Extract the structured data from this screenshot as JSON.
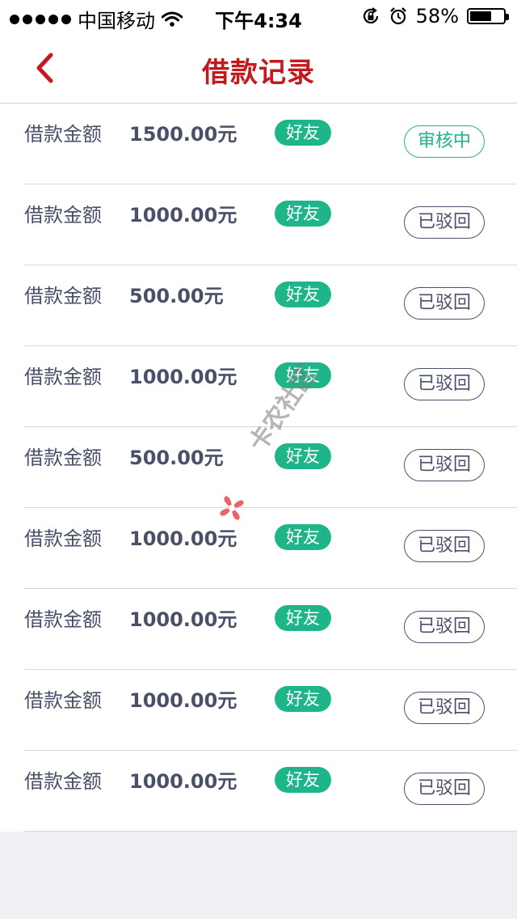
{
  "status_bar": {
    "carrier": "中国移动",
    "time": "下午4:34",
    "battery_text": "58%",
    "battery_level": 0.58,
    "icons": [
      "signal-dots-icon",
      "wifi-icon",
      "rotation-lock-icon",
      "alarm-icon",
      "battery-icon"
    ]
  },
  "nav": {
    "title": "借款记录",
    "back_icon": "chevron-left-icon",
    "accent_color": "#c3191f"
  },
  "colors": {
    "green": "#1fb58a",
    "text": "#4a5068",
    "background": "#eef0f4"
  },
  "records": [
    {
      "label": "借款金额",
      "amount": "1500.00元",
      "tag": "好友",
      "status": "审核中",
      "status_type": "pending"
    },
    {
      "label": "借款金额",
      "amount": "1000.00元",
      "tag": "好友",
      "status": "已驳回",
      "status_type": "rejected"
    },
    {
      "label": "借款金额",
      "amount": "500.00元",
      "tag": "好友",
      "status": "已驳回",
      "status_type": "rejected"
    },
    {
      "label": "借款金额",
      "amount": "1000.00元",
      "tag": "好友",
      "status": "已驳回",
      "status_type": "rejected"
    },
    {
      "label": "借款金额",
      "amount": "500.00元",
      "tag": "好友",
      "status": "已驳回",
      "status_type": "rejected"
    },
    {
      "label": "借款金额",
      "amount": "1000.00元",
      "tag": "好友",
      "status": "已驳回",
      "status_type": "rejected"
    },
    {
      "label": "借款金额",
      "amount": "1000.00元",
      "tag": "好友",
      "status": "已驳回",
      "status_type": "rejected"
    },
    {
      "label": "借款金额",
      "amount": "1000.00元",
      "tag": "好友",
      "status": "已驳回",
      "status_type": "rejected"
    },
    {
      "label": "借款金额",
      "amount": "1000.00元",
      "tag": "好友",
      "status": "已驳回",
      "status_type": "rejected"
    }
  ],
  "watermark": {
    "text": "卡农社区",
    "icon": "flower-logo-icon"
  }
}
